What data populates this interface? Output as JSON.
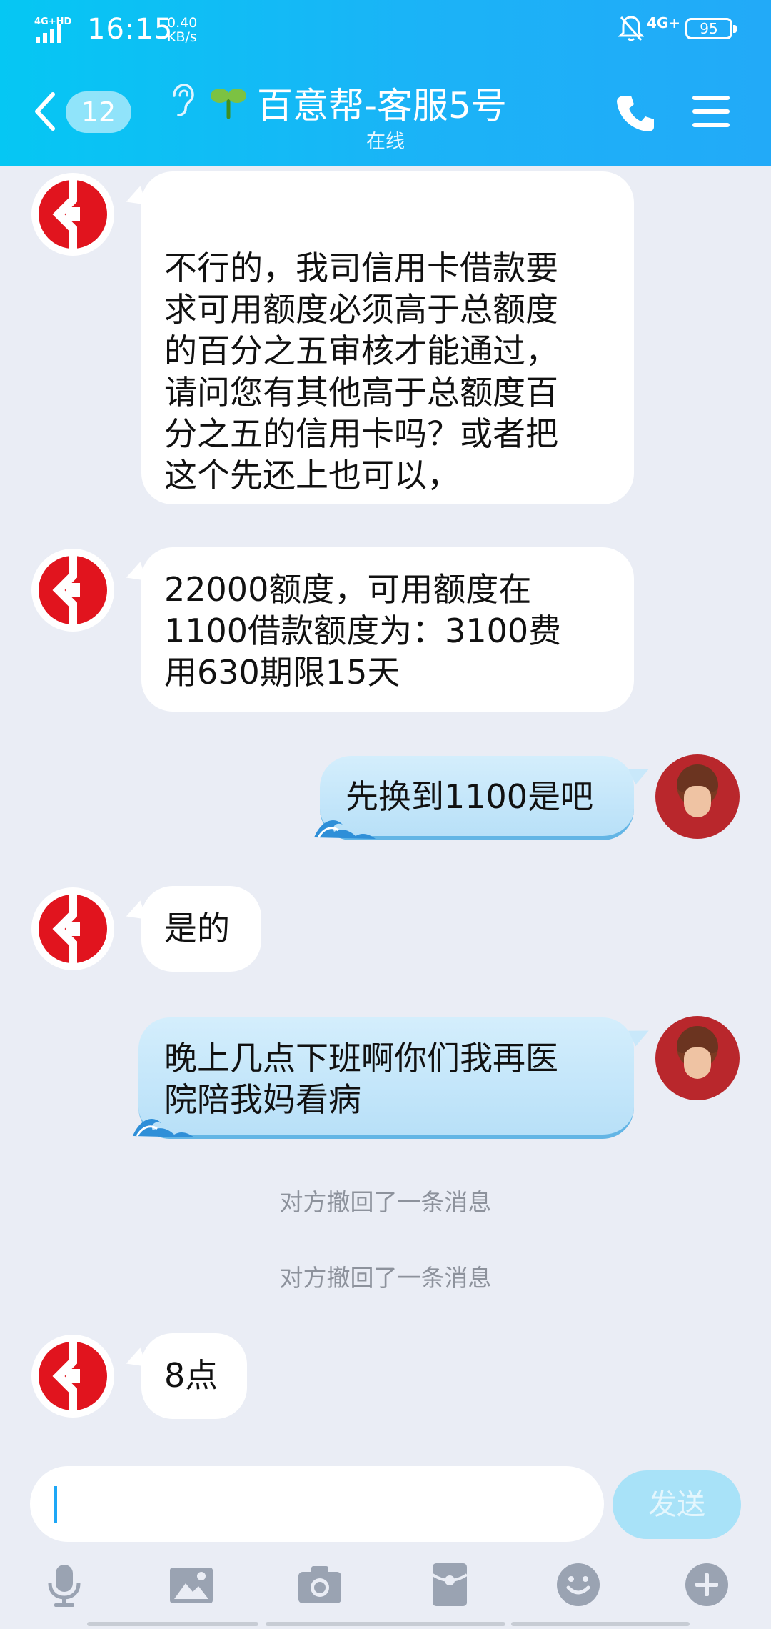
{
  "status_bar": {
    "network_left": "4G+HD",
    "time": "16:15",
    "speed_value": "0.40",
    "speed_unit": "KB/s",
    "network_right": "4G+",
    "battery": "95"
  },
  "nav": {
    "unread_count": "12",
    "title": "百意帮-客服5号",
    "status": "在线"
  },
  "messages": [
    {
      "from": "agent",
      "text": "\n不行的，我司信用卡借款要\n求可用额度必须高于总额度\n的百分之五审核才能通过，\n请问您有其他高于总额度百\n分之五的信用卡吗？或者把\n这个先还上也可以，"
    },
    {
      "from": "agent",
      "text": "22000额度，可用额度在\n1100借款额度为：3100费\n用630期限15天"
    },
    {
      "from": "me",
      "text": "先换到1100是吧"
    },
    {
      "from": "agent",
      "text": "是的"
    },
    {
      "from": "me",
      "text": "晚上几点下班啊你们我再医\n院陪我妈看病"
    },
    {
      "from": "system",
      "text": "对方撤回了一条消息"
    },
    {
      "from": "system",
      "text": "对方撤回了一条消息"
    },
    {
      "from": "agent",
      "text": "8点"
    }
  ],
  "input": {
    "placeholder": "",
    "send_label": "发送"
  },
  "toolbar": {
    "icons": [
      "microphone-icon",
      "image-icon",
      "camera-icon",
      "red-packet-icon",
      "emoji-icon",
      "plus-icon"
    ]
  },
  "colors": {
    "header": "#1bb3f7",
    "background": "#eaedf5",
    "outgoing_bubble": "#c4e6fa",
    "send_button": "#a8e2f8",
    "logo_red": "#e1141e"
  }
}
